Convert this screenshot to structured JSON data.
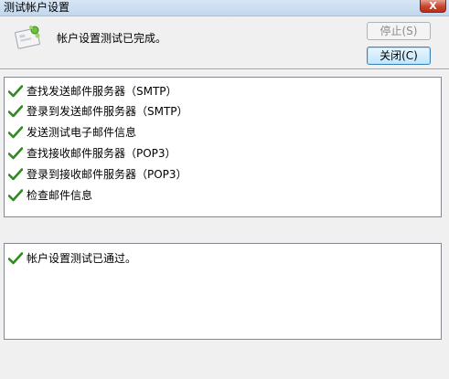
{
  "window": {
    "title": "测试帐户设置",
    "close_glyph": "X"
  },
  "header": {
    "icon": "account-settings-icon",
    "message": "帐户设置测试已完成。",
    "stop_button": "停止(S)",
    "close_button": "关闭(C)"
  },
  "tasks": [
    {
      "label": "查找发送邮件服务器（SMTP）",
      "status_icon": "checkmark-icon"
    },
    {
      "label": "登录到发送邮件服务器（SMTP）",
      "status_icon": "checkmark-icon"
    },
    {
      "label": "发送测试电子邮件信息",
      "status_icon": "checkmark-icon"
    },
    {
      "label": "查找接收邮件服务器（POP3）",
      "status_icon": "checkmark-icon"
    },
    {
      "label": "登录到接收邮件服务器（POP3）",
      "status_icon": "checkmark-icon"
    },
    {
      "label": "检查邮件信息",
      "status_icon": "checkmark-icon"
    }
  ],
  "result": {
    "label": "帐户设置测试已通过。",
    "status_icon": "checkmark-icon"
  },
  "colors": {
    "check_green": "#2f8a1f",
    "title_bar": "#c9dcf0",
    "close_red": "#c7452c"
  }
}
